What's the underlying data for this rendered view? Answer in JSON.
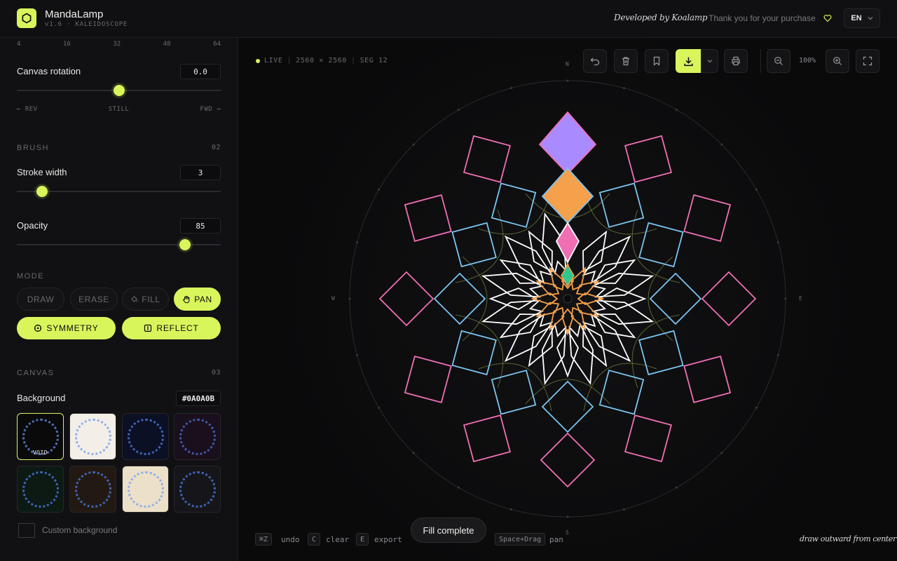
{
  "app": {
    "title": "MandaLamp",
    "subtitle": "v1.6 · KALEIDOSCOPE"
  },
  "header": {
    "developer": "Developed by Koalamp",
    "thanks": "Thank you for your purchase",
    "language": "EN"
  },
  "sidebar": {
    "segment_ticks": [
      "4",
      "16",
      "32",
      "48",
      "64"
    ],
    "rotation": {
      "label": "Canvas rotation",
      "value": "0.0",
      "level": 0.5,
      "rev": "← REV",
      "still": "STILL",
      "fwd": "FWD →"
    },
    "brush": {
      "section": "BRUSH",
      "section_num": "02",
      "stroke_label": "Stroke width",
      "stroke_value": "3",
      "opacity_label": "Opacity",
      "opacity_value": "85"
    },
    "mode": {
      "section": "MODE",
      "buttons": [
        "DRAW",
        "ERASE",
        "FILL",
        "PAN"
      ],
      "active": "PAN",
      "symmetry": "SYMMETRY",
      "reflect": "REFLECT"
    },
    "canvas": {
      "section": "CANVAS",
      "section_num": "03",
      "background_label": "Background",
      "background_hex": "#0A0A0B",
      "swatches": [
        {
          "name": "VOID",
          "color": "#0a0a0b"
        },
        {
          "color": "#f3efe8"
        },
        {
          "color": "#0b1024"
        },
        {
          "color": "#1a0f1c"
        },
        {
          "color": "#0d1a14"
        },
        {
          "color": "#221a12"
        },
        {
          "color": "#ece0c8"
        },
        {
          "color": "#16161a"
        }
      ],
      "custom_label": "Custom background"
    }
  },
  "canvas_view": {
    "live": "LIVE",
    "resolution": "2560 × 2560",
    "segments": "SEG 12",
    "zoom": "100%",
    "compass": {
      "n": "N",
      "s": "S",
      "e": "E",
      "w": "W"
    }
  },
  "shortcuts": [
    {
      "key": "⌘Z",
      "label": "undo"
    },
    {
      "key": "C",
      "label": "clear"
    },
    {
      "key": "E",
      "label": "export"
    },
    {
      "key": "Space+Drag",
      "label": "pan"
    }
  ],
  "toast": "Fill complete",
  "hint": "draw outward from center",
  "colors": {
    "accent": "#d9f55c",
    "pink": "#f06fb4",
    "blue": "#7cc4f0",
    "orange": "#f5a04a",
    "purple": "#a98bff",
    "green": "#2fc790",
    "white": "#ffffff",
    "olive": "#7a8a3a"
  }
}
